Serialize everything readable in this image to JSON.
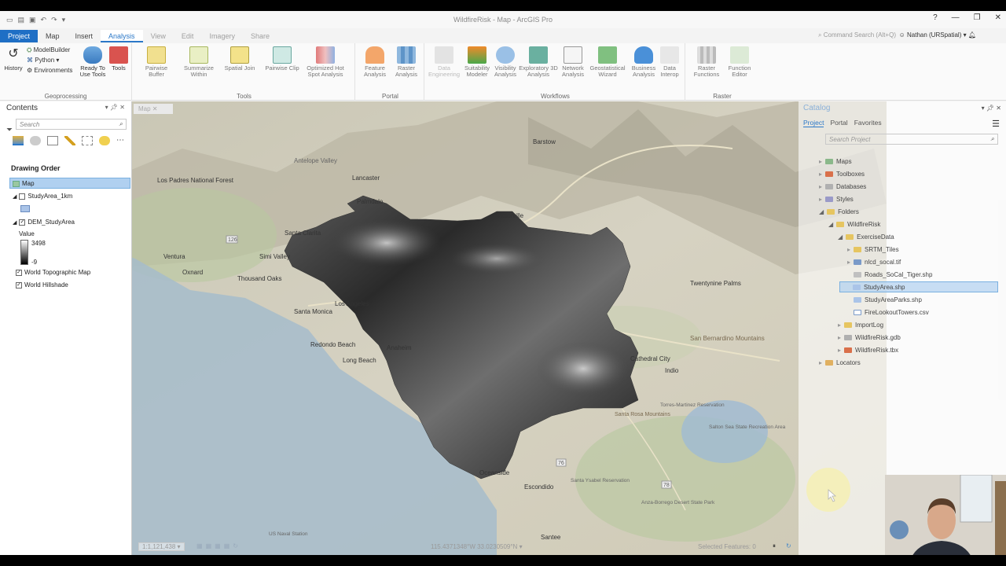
{
  "window": {
    "title": "WildfireRisk - Map - ArcGIS Pro",
    "help_icon": "?",
    "minimize_icon": "—",
    "restore_icon": "❐",
    "close_icon": "✕"
  },
  "tabs": [
    "Project",
    "Map",
    "Insert",
    "Analysis",
    "View",
    "Edit",
    "Imagery",
    "Share"
  ],
  "command_search": {
    "placeholder": "Command Search (Alt+Q)"
  },
  "user": {
    "name": "Nathan (URSpatial)"
  },
  "ribbon": {
    "geoprocessing": {
      "label": "Geoprocessing",
      "history": "History",
      "modelbuilder": "ModelBuilder",
      "python": "Python",
      "environments": "Environments",
      "ready_to_use": "Ready To Use Tools",
      "tools": "Tools"
    },
    "tools_group": {
      "label": "Tools",
      "buttons": [
        "Pairwise Buffer",
        "Summarize Within",
        "Spatial Join",
        "Pairwise Clip",
        "Optimized Hot Spot Analysis"
      ]
    },
    "portal_group": {
      "label": "Portal",
      "buttons": [
        "Feature Analysis",
        "Raster Analysis"
      ]
    },
    "workflows_group": {
      "label": "Workflows",
      "buttons": [
        "Data Engineering",
        "Suitability Modeler",
        "Visibility Analysis",
        "Exploratory 3D Analysis",
        "Network Analysis",
        "Geostatistical Wizard",
        "Business Analysis",
        "Data Interop"
      ]
    },
    "raster_group": {
      "label": "Raster",
      "buttons": [
        "Raster Functions",
        "Function Editor"
      ]
    }
  },
  "contents": {
    "title": "Contents",
    "search_placeholder": "Search",
    "drawing_order": "Drawing Order",
    "layers": {
      "map": "Map",
      "study_area": "StudyArea_1km",
      "dem": "DEM_StudyArea",
      "value_label": "Value",
      "value_max": "3498",
      "value_min": "-9",
      "topo": "World Topographic Map",
      "hillshade": "World Hillshade"
    }
  },
  "map": {
    "tab": "Map",
    "places": [
      "Los Padres National Forest",
      "Antelope Valley",
      "Lancaster",
      "Palmdale",
      "Barstow",
      "Ventura",
      "Oxnard",
      "Santa Clarita",
      "Simi Valley",
      "Thousand Oaks",
      "Los Angeles",
      "Santa Monica",
      "Redondo Beach",
      "Long Beach",
      "Anaheim",
      "Twentynine Palms",
      "San Bernardino Mountains",
      "Indio",
      "Cathedral City",
      "Torres-Martinez Reservation",
      "Salton Sea State Recreation Area",
      "Santa Rosa Mountains",
      "Escondido",
      "Santa Ysabel Reservation",
      "Anza-Borrego Desert State Park",
      "US Naval Station",
      "Santee",
      "Oceanside",
      "Victorville"
    ],
    "road_shields": [
      "126",
      "76",
      "78"
    ]
  },
  "status": {
    "scale": "1:1,121,438",
    "coords": "115.4371348°W 33.0230509°N",
    "selected": "Selected Features: 0"
  },
  "catalog": {
    "title": "Catalog",
    "tabs": [
      "Project",
      "Portal",
      "Favorites"
    ],
    "search_placeholder": "Search Project",
    "items": {
      "maps": "Maps",
      "toolboxes": "Toolboxes",
      "databases": "Databases",
      "styles": "Styles",
      "folders": "Folders",
      "wildfirerisk": "WildfireRisk",
      "exercisedata": "ExerciseData",
      "srtm": "SRTM_Tiles",
      "nlcd": "nlcd_socal.tif",
      "roads": "Roads_SoCal_Tiger.shp",
      "studyarea": "StudyArea.shp",
      "parks": "StudyAreaParks.shp",
      "towers": "FireLookoutTowers.csv",
      "importlog": "ImportLog",
      "gdb": "WildfireRisk.gdb",
      "tbx": "WildfireRisk.tbx",
      "locators": "Locators"
    }
  },
  "colors": {
    "project_tab": "#1f6fc5",
    "accent": "#2b78c8",
    "selection": "#b0d0f0"
  }
}
